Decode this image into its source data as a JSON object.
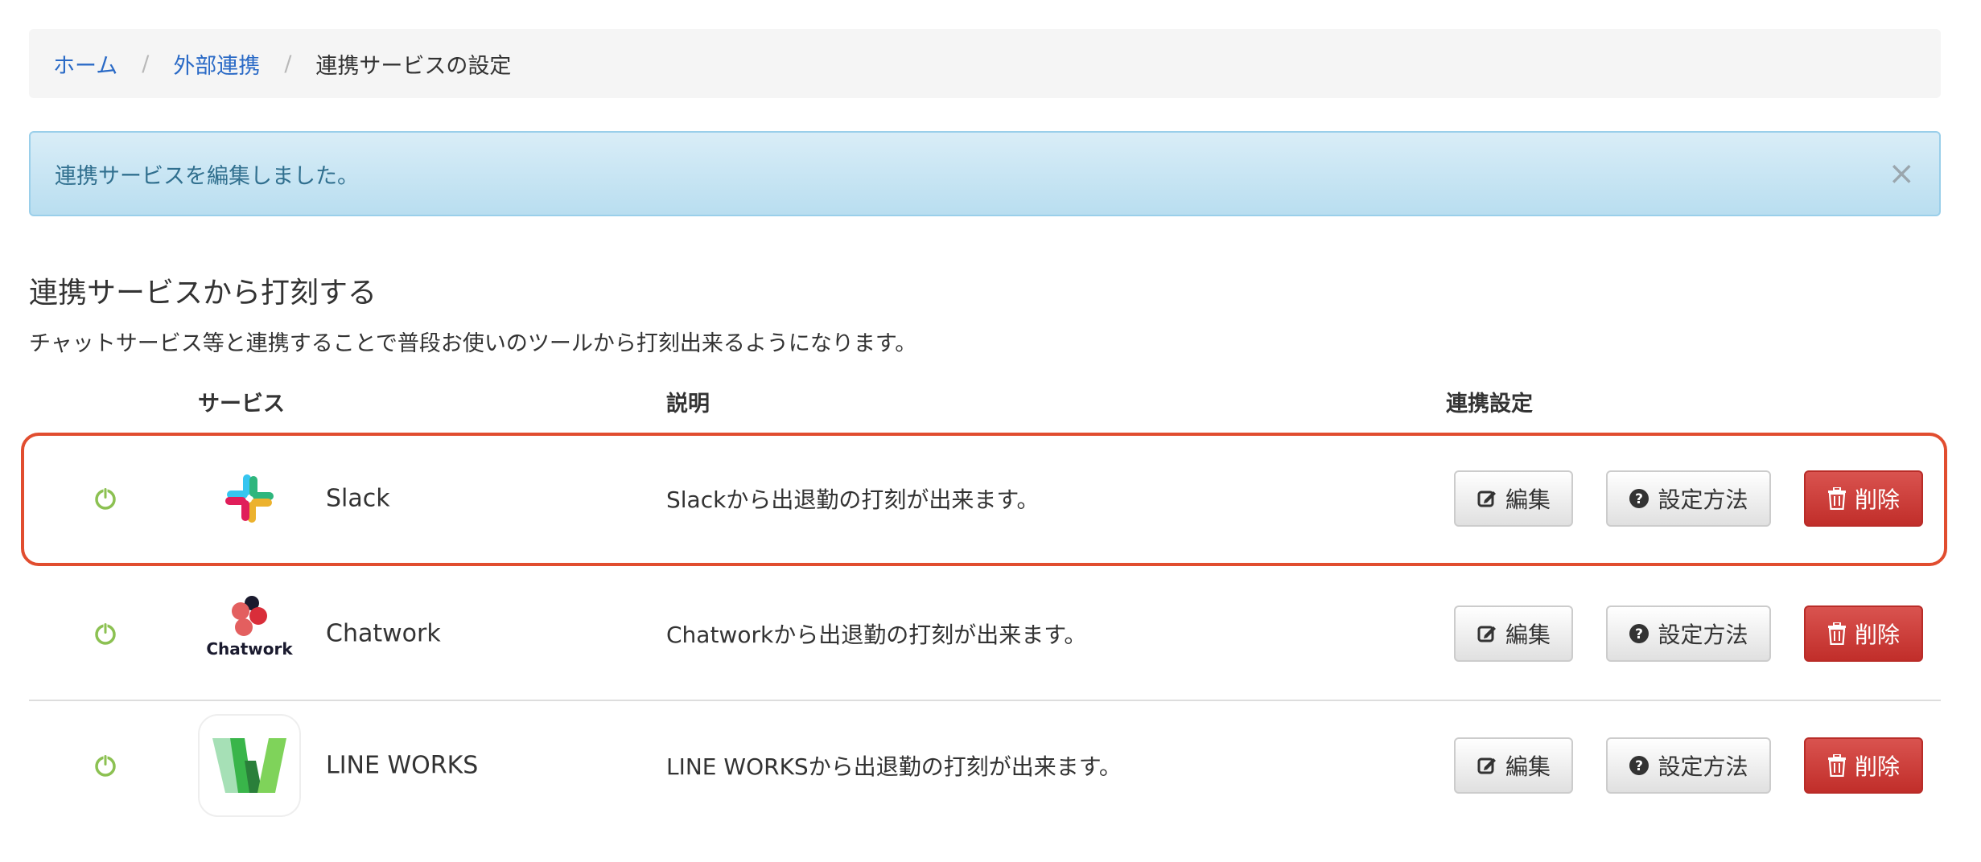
{
  "breadcrumb": {
    "home": "ホーム",
    "integrations": "外部連携",
    "current": "連携サービスの設定",
    "separator": "/"
  },
  "alert": {
    "message": "連携サービスを編集しました。",
    "close": "×"
  },
  "section": {
    "title": "連携サービスから打刻する",
    "description": "チャットサービス等と連携することで普段お使いのツールから打刻出来るようになります。"
  },
  "table": {
    "headers": {
      "service": "サービス",
      "description": "説明",
      "settings": "連携設定"
    },
    "rows": [
      {
        "name": "Slack",
        "description": "Slackから出退勤の打刻が出来ます。",
        "status_icon": "power-icon",
        "logo_icon": "slack-logo-icon"
      },
      {
        "name": "Chatwork",
        "description": "Chatworkから出退勤の打刻が出来ます。",
        "status_icon": "power-icon",
        "logo_icon": "chatwork-logo-icon",
        "logo_text": "Chatwork"
      },
      {
        "name": "LINE WORKS",
        "description": "LINE WORKSから出退勤の打刻が出来ます。",
        "status_icon": "power-icon",
        "logo_icon": "line-works-logo-icon"
      }
    ]
  },
  "buttons": {
    "edit": "編集",
    "setup": "設定方法",
    "delete": "削除"
  },
  "colors": {
    "link": "#2a6ac6",
    "alert_text": "#31708f",
    "danger": "#d9534f",
    "highlight_border": "#e14d2f",
    "power_green": "#8cc152"
  }
}
